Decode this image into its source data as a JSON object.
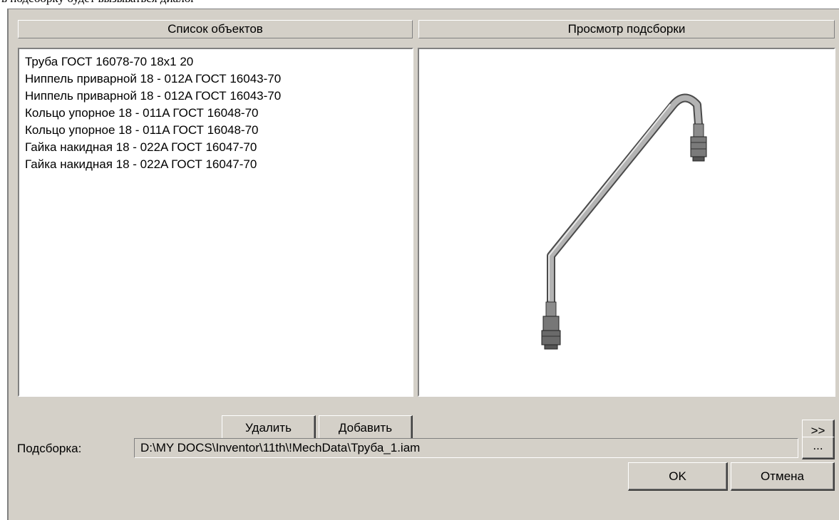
{
  "caption": "в подсборку будет вызываться диалог",
  "left_panel": {
    "header": "Список объектов",
    "items": [
      "Труба ГОСТ 16078-70 18x1 20",
      "Ниппель приварной 18 - 012A ГОСТ 16043-70",
      "Ниппель приварной 18 - 012A ГОСТ 16043-70",
      "Кольцо упорное 18 - 011A ГОСТ 16048-70",
      "Кольцо упорное 18 - 011A ГОСТ 16048-70",
      "Гайка накидная 18 - 022A ГОСТ 16047-70",
      "Гайка накидная 18 - 022A ГОСТ 16047-70"
    ]
  },
  "right_panel": {
    "header": "Просмотр подсборки",
    "preview_icon": "pipe-assembly-preview"
  },
  "buttons": {
    "delete": "Удалить",
    "add": "Добавить",
    "expand": ">>",
    "browse": "...",
    "ok": "OK",
    "cancel": "Отмена"
  },
  "subassembly": {
    "label": "Подсборка:",
    "path": "D:\\MY DOCS\\Inventor\\11th\\!MechData\\Труба_1.iam"
  },
  "colors": {
    "dialog_bg": "#d4d0c8",
    "panel_bg": "#ffffff",
    "pipe": "#9a9a9a"
  }
}
